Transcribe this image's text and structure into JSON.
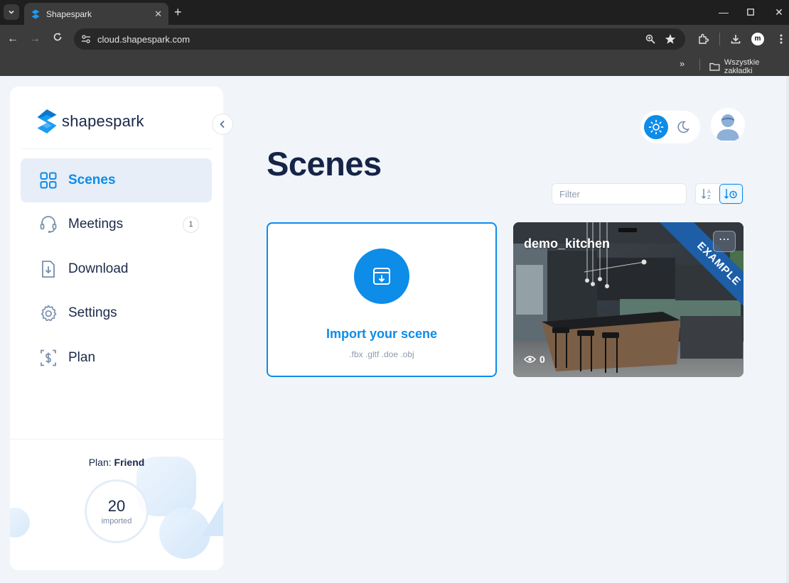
{
  "browser": {
    "tab_title": "Shapespark",
    "url": "cloud.shapespark.com",
    "bookmarks_more": "»",
    "bookmarks_folder_label": "Wszystkie zakładki",
    "profile_initial": "m"
  },
  "sidebar": {
    "brand": "shapespark",
    "nav": [
      {
        "label": "Scenes",
        "icon": "grid-icon",
        "active": true
      },
      {
        "label": "Meetings",
        "icon": "headset-icon",
        "badge": "1"
      },
      {
        "label": "Download",
        "icon": "download-file-icon"
      },
      {
        "label": "Settings",
        "icon": "gear-icon"
      },
      {
        "label": "Plan",
        "icon": "dollar-doc-icon"
      }
    ],
    "plan": {
      "prefix": "Plan:",
      "name": "Friend",
      "count": "20",
      "unit": "imported"
    }
  },
  "main": {
    "title": "Scenes",
    "filter_placeholder": "Filter",
    "import_card": {
      "title": "Import your scene",
      "formats": ".fbx .gltf .doe .obj"
    },
    "scenes": [
      {
        "name": "demo_kitchen",
        "ribbon": "EXAMPLE",
        "views": "0"
      }
    ]
  },
  "colors": {
    "accent": "#0d8ce8",
    "navy": "#162447",
    "ribbon": "#1d5ea7",
    "page_bg": "#f1f5fa"
  }
}
